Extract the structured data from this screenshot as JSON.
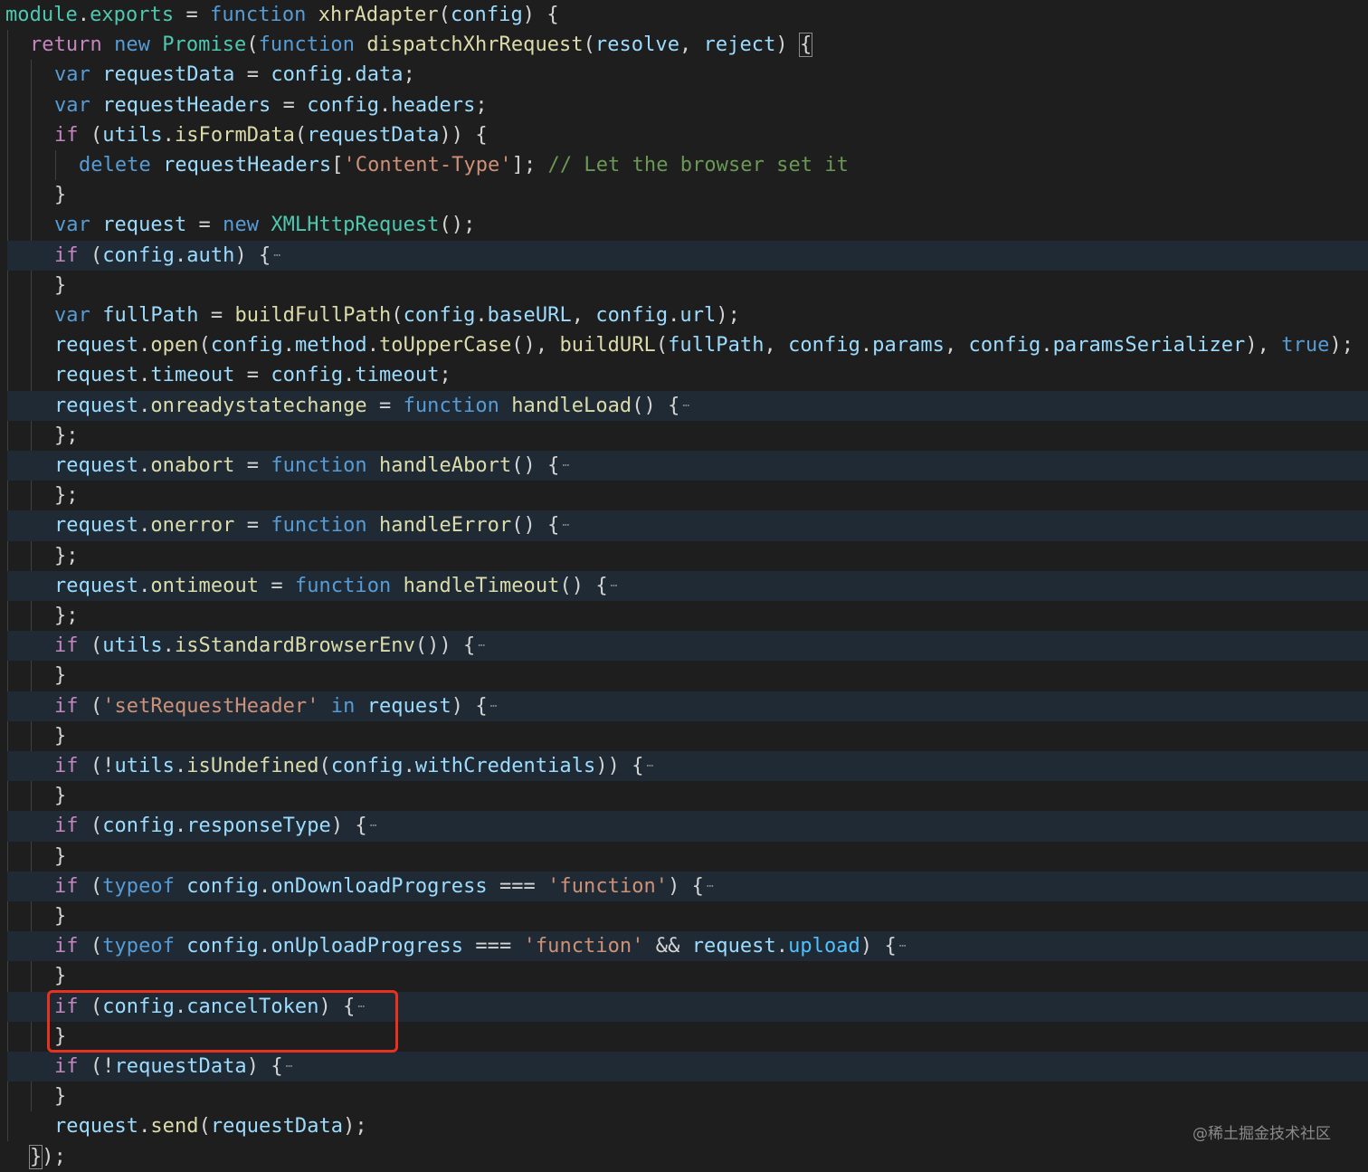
{
  "lines": [
    {
      "i": 0,
      "hl": false,
      "t": [
        [
          "cls",
          "module"
        ],
        [
          "p",
          "."
        ],
        [
          "cls",
          "exports"
        ],
        [
          "p",
          " = "
        ],
        [
          "s",
          "function"
        ],
        [
          "p",
          " "
        ],
        [
          "f",
          "xhrAdapter"
        ],
        [
          "p",
          "("
        ],
        [
          "v",
          "config"
        ],
        [
          "p",
          ") {"
        ]
      ]
    },
    {
      "i": 1,
      "hl": false,
      "t": [
        [
          "k",
          "return"
        ],
        [
          "p",
          " "
        ],
        [
          "s",
          "new"
        ],
        [
          "p",
          " "
        ],
        [
          "cls",
          "Promise"
        ],
        [
          "p",
          "("
        ],
        [
          "s",
          "function"
        ],
        [
          "p",
          " "
        ],
        [
          "f",
          "dispatchXhrRequest"
        ],
        [
          "p",
          "("
        ],
        [
          "v",
          "resolve"
        ],
        [
          "p",
          ", "
        ],
        [
          "v",
          "reject"
        ],
        [
          "p",
          ") "
        ],
        [
          "bm",
          "{"
        ]
      ]
    },
    {
      "i": 2,
      "hl": false,
      "t": [
        [
          "s",
          "var"
        ],
        [
          "p",
          " "
        ],
        [
          "v",
          "requestData"
        ],
        [
          "p",
          " = "
        ],
        [
          "v",
          "config"
        ],
        [
          "p",
          "."
        ],
        [
          "v",
          "data"
        ],
        [
          "p",
          ";"
        ]
      ]
    },
    {
      "i": 2,
      "hl": false,
      "t": [
        [
          "s",
          "var"
        ],
        [
          "p",
          " "
        ],
        [
          "v",
          "requestHeaders"
        ],
        [
          "p",
          " = "
        ],
        [
          "v",
          "config"
        ],
        [
          "p",
          "."
        ],
        [
          "v",
          "headers"
        ],
        [
          "p",
          ";"
        ]
      ]
    },
    {
      "i": 2,
      "hl": false,
      "t": [
        [
          "k",
          "if"
        ],
        [
          "p",
          " ("
        ],
        [
          "v",
          "utils"
        ],
        [
          "p",
          "."
        ],
        [
          "f",
          "isFormData"
        ],
        [
          "p",
          "("
        ],
        [
          "v",
          "requestData"
        ],
        [
          "p",
          ")) {"
        ]
      ]
    },
    {
      "i": 3,
      "hl": false,
      "t": [
        [
          "s",
          "delete"
        ],
        [
          "p",
          " "
        ],
        [
          "v",
          "requestHeaders"
        ],
        [
          "p",
          "["
        ],
        [
          "str",
          "'Content-Type'"
        ],
        [
          "p",
          "]; "
        ],
        [
          "c",
          "// Let the browser set it"
        ]
      ]
    },
    {
      "i": 2,
      "hl": false,
      "t": [
        [
          "p",
          "}"
        ]
      ]
    },
    {
      "i": 2,
      "hl": false,
      "t": [
        [
          "s",
          "var"
        ],
        [
          "p",
          " "
        ],
        [
          "v",
          "request"
        ],
        [
          "p",
          " = "
        ],
        [
          "s",
          "new"
        ],
        [
          "p",
          " "
        ],
        [
          "cls",
          "XMLHttpRequest"
        ],
        [
          "p",
          "();"
        ]
      ]
    },
    {
      "i": 2,
      "hl": true,
      "t": [
        [
          "k",
          "if"
        ],
        [
          "p",
          " ("
        ],
        [
          "v",
          "config"
        ],
        [
          "p",
          "."
        ],
        [
          "v",
          "auth"
        ],
        [
          "p",
          ") {"
        ],
        [
          "e",
          "⋯"
        ]
      ]
    },
    {
      "i": 2,
      "hl": false,
      "t": [
        [
          "p",
          "}"
        ]
      ]
    },
    {
      "i": 2,
      "hl": false,
      "t": [
        [
          "s",
          "var"
        ],
        [
          "p",
          " "
        ],
        [
          "v",
          "fullPath"
        ],
        [
          "p",
          " = "
        ],
        [
          "f",
          "buildFullPath"
        ],
        [
          "p",
          "("
        ],
        [
          "v",
          "config"
        ],
        [
          "p",
          "."
        ],
        [
          "v",
          "baseURL"
        ],
        [
          "p",
          ", "
        ],
        [
          "v",
          "config"
        ],
        [
          "p",
          "."
        ],
        [
          "v",
          "url"
        ],
        [
          "p",
          ");"
        ]
      ]
    },
    {
      "i": 2,
      "hl": false,
      "t": [
        [
          "v",
          "request"
        ],
        [
          "p",
          "."
        ],
        [
          "f",
          "open"
        ],
        [
          "p",
          "("
        ],
        [
          "v",
          "config"
        ],
        [
          "p",
          "."
        ],
        [
          "v",
          "method"
        ],
        [
          "p",
          "."
        ],
        [
          "f",
          "toUpperCase"
        ],
        [
          "p",
          "(), "
        ],
        [
          "f",
          "buildURL"
        ],
        [
          "p",
          "("
        ],
        [
          "v",
          "fullPath"
        ],
        [
          "p",
          ", "
        ],
        [
          "v",
          "config"
        ],
        [
          "p",
          "."
        ],
        [
          "v",
          "params"
        ],
        [
          "p",
          ", "
        ],
        [
          "v",
          "config"
        ],
        [
          "p",
          "."
        ],
        [
          "v",
          "paramsSerializer"
        ],
        [
          "p",
          "), "
        ],
        [
          "s",
          "true"
        ],
        [
          "p",
          ");"
        ]
      ]
    },
    {
      "i": 2,
      "hl": false,
      "t": [
        [
          "v",
          "request"
        ],
        [
          "p",
          "."
        ],
        [
          "v",
          "timeout"
        ],
        [
          "p",
          " = "
        ],
        [
          "v",
          "config"
        ],
        [
          "p",
          "."
        ],
        [
          "v",
          "timeout"
        ],
        [
          "p",
          ";"
        ]
      ]
    },
    {
      "i": 2,
      "hl": true,
      "t": [
        [
          "v",
          "request"
        ],
        [
          "p",
          "."
        ],
        [
          "f",
          "onreadystatechange"
        ],
        [
          "p",
          " = "
        ],
        [
          "s",
          "function"
        ],
        [
          "p",
          " "
        ],
        [
          "f",
          "handleLoad"
        ],
        [
          "p",
          "() {"
        ],
        [
          "e",
          "⋯"
        ]
      ]
    },
    {
      "i": 2,
      "hl": false,
      "t": [
        [
          "p",
          "};"
        ]
      ]
    },
    {
      "i": 2,
      "hl": true,
      "t": [
        [
          "v",
          "request"
        ],
        [
          "p",
          "."
        ],
        [
          "f",
          "onabort"
        ],
        [
          "p",
          " = "
        ],
        [
          "s",
          "function"
        ],
        [
          "p",
          " "
        ],
        [
          "f",
          "handleAbort"
        ],
        [
          "p",
          "() {"
        ],
        [
          "e",
          "⋯"
        ]
      ]
    },
    {
      "i": 2,
      "hl": false,
      "t": [
        [
          "p",
          "};"
        ]
      ]
    },
    {
      "i": 2,
      "hl": true,
      "t": [
        [
          "v",
          "request"
        ],
        [
          "p",
          "."
        ],
        [
          "f",
          "onerror"
        ],
        [
          "p",
          " = "
        ],
        [
          "s",
          "function"
        ],
        [
          "p",
          " "
        ],
        [
          "f",
          "handleError"
        ],
        [
          "p",
          "() {"
        ],
        [
          "e",
          "⋯"
        ]
      ]
    },
    {
      "i": 2,
      "hl": false,
      "t": [
        [
          "p",
          "};"
        ]
      ]
    },
    {
      "i": 2,
      "hl": true,
      "t": [
        [
          "v",
          "request"
        ],
        [
          "p",
          "."
        ],
        [
          "f",
          "ontimeout"
        ],
        [
          "p",
          " = "
        ],
        [
          "s",
          "function"
        ],
        [
          "p",
          " "
        ],
        [
          "f",
          "handleTimeout"
        ],
        [
          "p",
          "() {"
        ],
        [
          "e",
          "⋯"
        ]
      ]
    },
    {
      "i": 2,
      "hl": false,
      "t": [
        [
          "p",
          "};"
        ]
      ]
    },
    {
      "i": 2,
      "hl": true,
      "t": [
        [
          "k",
          "if"
        ],
        [
          "p",
          " ("
        ],
        [
          "v",
          "utils"
        ],
        [
          "p",
          "."
        ],
        [
          "f",
          "isStandardBrowserEnv"
        ],
        [
          "p",
          "()) {"
        ],
        [
          "e",
          "⋯"
        ]
      ]
    },
    {
      "i": 2,
      "hl": false,
      "t": [
        [
          "p",
          "}"
        ]
      ]
    },
    {
      "i": 2,
      "hl": true,
      "t": [
        [
          "k",
          "if"
        ],
        [
          "p",
          " ("
        ],
        [
          "str",
          "'setRequestHeader'"
        ],
        [
          "p",
          " "
        ],
        [
          "s",
          "in"
        ],
        [
          "p",
          " "
        ],
        [
          "v",
          "request"
        ],
        [
          "p",
          ") {"
        ],
        [
          "e",
          "⋯"
        ]
      ]
    },
    {
      "i": 2,
      "hl": false,
      "t": [
        [
          "p",
          "}"
        ]
      ]
    },
    {
      "i": 2,
      "hl": true,
      "t": [
        [
          "k",
          "if"
        ],
        [
          "p",
          " (!"
        ],
        [
          "v",
          "utils"
        ],
        [
          "p",
          "."
        ],
        [
          "f",
          "isUndefined"
        ],
        [
          "p",
          "("
        ],
        [
          "v",
          "config"
        ],
        [
          "p",
          "."
        ],
        [
          "v",
          "withCredentials"
        ],
        [
          "p",
          ")) {"
        ],
        [
          "e",
          "⋯"
        ]
      ]
    },
    {
      "i": 2,
      "hl": false,
      "t": [
        [
          "p",
          "}"
        ]
      ]
    },
    {
      "i": 2,
      "hl": true,
      "t": [
        [
          "k",
          "if"
        ],
        [
          "p",
          " ("
        ],
        [
          "v",
          "config"
        ],
        [
          "p",
          "."
        ],
        [
          "v",
          "responseType"
        ],
        [
          "p",
          ") {"
        ],
        [
          "e",
          "⋯"
        ]
      ]
    },
    {
      "i": 2,
      "hl": false,
      "t": [
        [
          "p",
          "}"
        ]
      ]
    },
    {
      "i": 2,
      "hl": true,
      "t": [
        [
          "k",
          "if"
        ],
        [
          "p",
          " ("
        ],
        [
          "s",
          "typeof"
        ],
        [
          "p",
          " "
        ],
        [
          "v",
          "config"
        ],
        [
          "p",
          "."
        ],
        [
          "v",
          "onDownloadProgress"
        ],
        [
          "p",
          " === "
        ],
        [
          "str",
          "'function'"
        ],
        [
          "p",
          ") {"
        ],
        [
          "e",
          "⋯"
        ]
      ]
    },
    {
      "i": 2,
      "hl": false,
      "t": [
        [
          "p",
          "}"
        ]
      ]
    },
    {
      "i": 2,
      "hl": true,
      "t": [
        [
          "k",
          "if"
        ],
        [
          "p",
          " ("
        ],
        [
          "s",
          "typeof"
        ],
        [
          "p",
          " "
        ],
        [
          "v",
          "config"
        ],
        [
          "p",
          "."
        ],
        [
          "v",
          "onUploadProgress"
        ],
        [
          "p",
          " === "
        ],
        [
          "str",
          "'function'"
        ],
        [
          "p",
          " && "
        ],
        [
          "v",
          "request"
        ],
        [
          "p",
          "."
        ],
        [
          "u",
          "upload"
        ],
        [
          "p",
          ") {"
        ],
        [
          "e",
          "⋯"
        ]
      ]
    },
    {
      "i": 2,
      "hl": false,
      "t": [
        [
          "p",
          "}"
        ]
      ]
    },
    {
      "i": 2,
      "hl": true,
      "t": [
        [
          "k",
          "if"
        ],
        [
          "p",
          " ("
        ],
        [
          "v",
          "config"
        ],
        [
          "p",
          "."
        ],
        [
          "v",
          "cancelToken"
        ],
        [
          "p",
          ") {"
        ],
        [
          "e",
          "⋯"
        ]
      ]
    },
    {
      "i": 2,
      "hl": false,
      "t": [
        [
          "p",
          "}"
        ]
      ]
    },
    {
      "i": 2,
      "hl": true,
      "t": [
        [
          "k",
          "if"
        ],
        [
          "p",
          " (!"
        ],
        [
          "v",
          "requestData"
        ],
        [
          "p",
          ") {"
        ],
        [
          "e",
          "⋯"
        ]
      ]
    },
    {
      "i": 2,
      "hl": false,
      "t": [
        [
          "p",
          "}"
        ]
      ]
    },
    {
      "i": 2,
      "hl": false,
      "t": [
        [
          "v",
          "request"
        ],
        [
          "p",
          "."
        ],
        [
          "f",
          "send"
        ],
        [
          "p",
          "("
        ],
        [
          "v",
          "requestData"
        ],
        [
          "p",
          ");"
        ]
      ]
    },
    {
      "i": 1,
      "hl": false,
      "t": [
        [
          "bm",
          "}"
        ],
        [
          "p",
          ");"
        ]
      ]
    }
  ],
  "watermark": "@稀土掘金技术社区",
  "colors": {
    "highlight_box": "#e8321f",
    "background": "#1e1e1e",
    "fold_highlight": "#1f2a35"
  }
}
